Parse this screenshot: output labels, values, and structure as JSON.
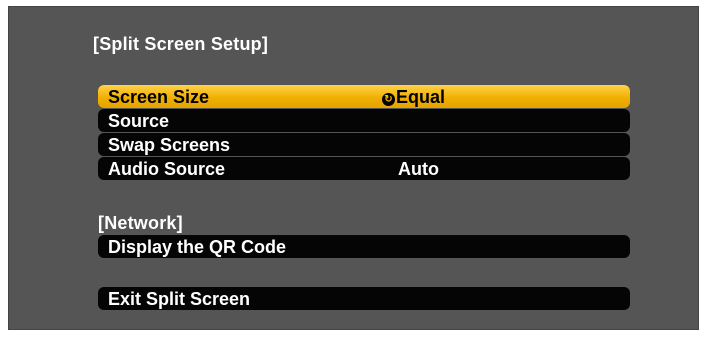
{
  "panel": {
    "title": "[Split Screen Setup]",
    "items": [
      {
        "label": "Screen Size",
        "value": "Equal"
      },
      {
        "label": "Source",
        "value": ""
      },
      {
        "label": "Swap Screens",
        "value": ""
      },
      {
        "label": "Audio Source",
        "value": "Auto"
      }
    ],
    "network_heading": "[Network]",
    "network_item": "Display the QR Code",
    "exit_item": "Exit Split Screen",
    "icons": {
      "screen_size_value": "cycle-arrow-icon"
    },
    "colors": {
      "panel_bg": "#555555",
      "row_bg": "#050505",
      "highlight": "#f5b800"
    }
  }
}
